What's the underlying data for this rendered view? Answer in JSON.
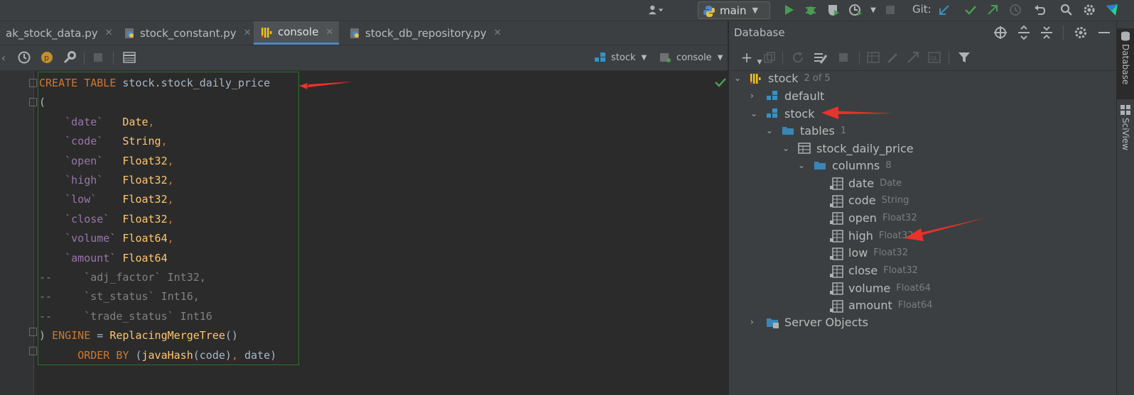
{
  "toolbar": {
    "branch": "main",
    "git_label": "Git:"
  },
  "tabs": [
    {
      "label": "ak_stock_data.py"
    },
    {
      "label": "stock_constant.py"
    },
    {
      "label": "console"
    },
    {
      "label": "stock_db_repository.py"
    }
  ],
  "editor_toolbar": {
    "schema_select": "stock",
    "console_select": "console"
  },
  "code": [
    "CREATE TABLE stock.stock_daily_price",
    "(",
    "    `date`   Date,",
    "    `code`   String,",
    "    `open`   Float32,",
    "    `high`   Float32,",
    "    `low`    Float32,",
    "    `close`  Float32,",
    "    `volume` Float64,",
    "    `amount` Float64",
    "--     `adj_factor` Int32,",
    "--     `st_status` Int16,",
    "--     `trade_status` Int16",
    ") ENGINE = ReplacingMergeTree()",
    "      ORDER BY (javaHash(code), date)"
  ],
  "database": {
    "title": "Database",
    "root": {
      "name": "stock",
      "count": "2 of 5"
    },
    "schemas": [
      {
        "name": "default"
      },
      {
        "name": "stock"
      }
    ],
    "tables_label": "tables",
    "tables_count": "1",
    "table_name": "stock_daily_price",
    "columns_label": "columns",
    "columns_count": "8",
    "columns": [
      {
        "name": "date",
        "type": "Date"
      },
      {
        "name": "code",
        "type": "String"
      },
      {
        "name": "open",
        "type": "Float32"
      },
      {
        "name": "high",
        "type": "Float32"
      },
      {
        "name": "low",
        "type": "Float32"
      },
      {
        "name": "close",
        "type": "Float32"
      },
      {
        "name": "volume",
        "type": "Float64"
      },
      {
        "name": "amount",
        "type": "Float64"
      }
    ],
    "server_objects": "Server Objects"
  },
  "right_strip": {
    "database": "Database",
    "sciview": "SciView"
  },
  "colors": {
    "accent": "#4a88c7",
    "annotation_arrow": "#e8322b",
    "run_green": "#499c54"
  }
}
